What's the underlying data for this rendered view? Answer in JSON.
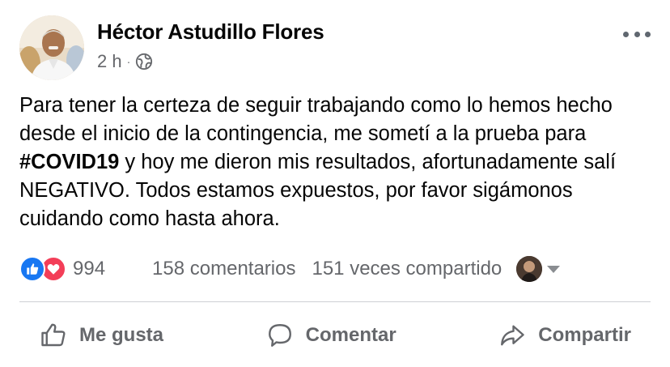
{
  "post": {
    "author": "Héctor Astudillo Flores",
    "time": "2 h",
    "separator": "·",
    "audience_icon": "globe-icon",
    "message": {
      "part1": "Para tener la certeza de seguir trabajando como lo hemos hecho desde el inicio de la contingencia, me sometí a la prueba para ",
      "hashtag": "#COVID19",
      "part2": " y hoy me dieron mis resultados, afortunadamente salí NEGATIVO. Todos estamos expuestos, por favor sigámonos cuidando como hasta ahora."
    },
    "stats": {
      "reaction_icons": [
        "like-icon",
        "love-icon"
      ],
      "reaction_count": "994",
      "comments": "158 comentarios",
      "shares": "151 veces compartido"
    },
    "actions": {
      "like": "Me gusta",
      "comment": "Comentar",
      "share": "Compartir"
    }
  },
  "colors": {
    "like_blue": "#1877f2",
    "love_red": "#f33e58",
    "secondary_text": "#65676b"
  }
}
